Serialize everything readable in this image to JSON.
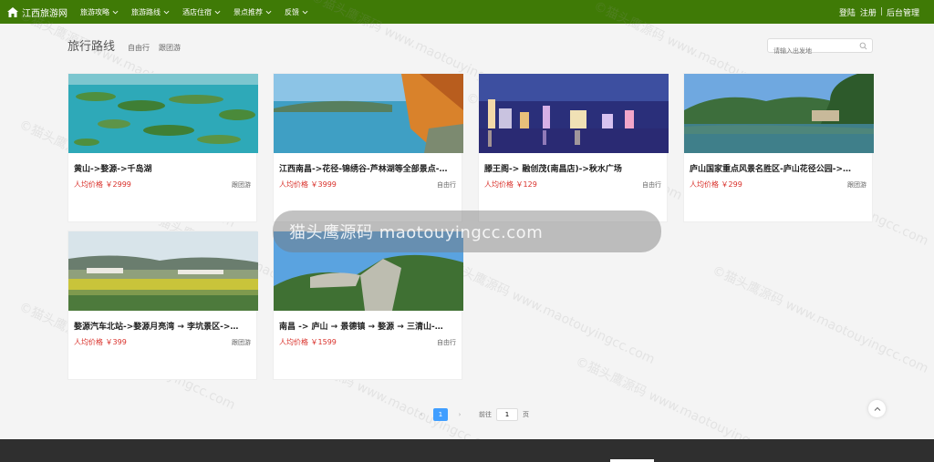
{
  "topbar": {
    "brand": "江西旅游网",
    "nav": [
      {
        "label": "旅游攻略"
      },
      {
        "label": "旅游路线"
      },
      {
        "label": "酒店住宿"
      },
      {
        "label": "景点推荐"
      },
      {
        "label": "反馈"
      }
    ],
    "login": "登陆",
    "register": "注册",
    "admin": "后台管理",
    "sep": "|"
  },
  "header": {
    "title": "旅行路线",
    "filters": [
      "自由行",
      "跟团游"
    ],
    "search_placeholder": "请输入出发地"
  },
  "cards": [
    {
      "title": "黄山->婺源->千岛湖",
      "price": "人均价格 ￥2999",
      "type": "跟团游"
    },
    {
      "title": "江西南昌->花径-锦绣谷-芦林湖等全部景点-…",
      "price": "人均价格 ￥3999",
      "type": "自由行"
    },
    {
      "title": "滕王阁-> 融创茂(南昌店)->秋水广场",
      "price": "人均价格 ￥129",
      "type": "自由行"
    },
    {
      "title": "庐山国家重点风景名胜区-庐山花径公园->…",
      "price": "人均价格 ￥299",
      "type": "跟团游"
    },
    {
      "title": "婺源汽车北站->婺源月亮湾 → 李坑景区->…",
      "price": "人均价格 ￥399",
      "type": "跟团游"
    },
    {
      "title": "南昌 -> 庐山 → 景德镇 → 婺源 → 三清山-…",
      "price": "人均价格 ￥1599",
      "type": "自由行"
    }
  ],
  "toast": "猫头鹰源码 maotouyingcc.com",
  "pager": {
    "current": "1",
    "goto_label": "前往",
    "goto_value": "1",
    "page_suffix": "页"
  },
  "watermark": "©猫头鹰源码 www.maotouyingcc.com",
  "colors": {
    "topbar": "#3f7a06",
    "price": "#d9302a",
    "pager_active": "#409eff",
    "footer": "#2f2f2f"
  },
  "icons": [
    "home-icon",
    "chevron-down-icon",
    "search-icon",
    "chevron-left-icon",
    "chevron-right-icon",
    "arrow-up-icon"
  ]
}
